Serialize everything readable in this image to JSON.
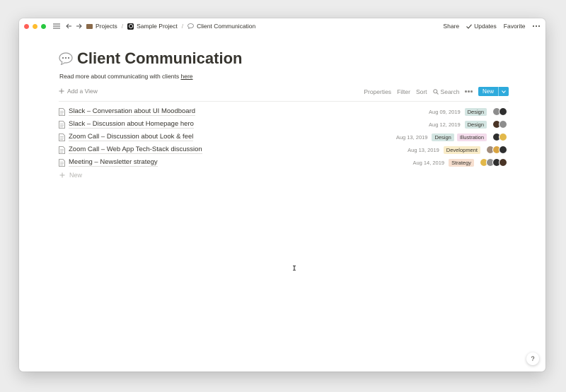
{
  "topbar": {
    "breadcrumbs": [
      {
        "label": "Projects",
        "icon": "briefcase-icon"
      },
      {
        "label": "Sample Project",
        "icon": "project-icon"
      },
      {
        "label": "Client Communication",
        "icon": "speech-bubble-icon"
      }
    ],
    "share_label": "Share",
    "updates_label": "Updates",
    "favorite_label": "Favorite"
  },
  "page": {
    "title": "Client Communication",
    "intro_text": "Read more about communicating with clients ",
    "intro_link": "here"
  },
  "viewbar": {
    "add_view": "Add a View",
    "properties": "Properties",
    "filter": "Filter",
    "sort": "Sort",
    "search": "Search",
    "new_button": "New"
  },
  "rows": [
    {
      "title": "Slack – Conversation about UI Moodboard",
      "date": "Aug 09, 2019",
      "tags": [
        "Design"
      ],
      "avatars": [
        "#8d8d8d",
        "#2f2f2f"
      ]
    },
    {
      "title": "Slack – Discussion about Homepage hero",
      "date": "Aug 12, 2019",
      "tags": [
        "Design"
      ],
      "avatars": [
        "#4a3426",
        "#8d8d8d"
      ]
    },
    {
      "title": "Zoom Call – Discussion about Look & feel",
      "date": "Aug 13, 2019",
      "tags": [
        "Design",
        "Illustration"
      ],
      "avatars": [
        "#2f2f2f",
        "#e2b84a"
      ]
    },
    {
      "title": "Zoom Call – Web App Tech-Stack discussion",
      "date": "Aug 13, 2019",
      "tags": [
        "Development"
      ],
      "avatars": [
        "#a08c7c",
        "#d9a441",
        "#2f2f2f"
      ]
    },
    {
      "title": "Meeting – Newsletter strategy",
      "date": "Aug 14, 2019",
      "tags": [
        "Strategy"
      ],
      "avatars": [
        "#e2b84a",
        "#8d8d8d",
        "#2f2f2f",
        "#4a3426"
      ]
    }
  ],
  "new_row_label": "New",
  "help_label": "?",
  "tag_colors": {
    "Design": "#d3e5e2",
    "Illustration": "#f4dcec",
    "Development": "#f9ecc8",
    "Strategy": "#f7dfcf"
  },
  "colors": {
    "accent": "#2eaadc",
    "text": "#37352f",
    "muted": "#8c8b88"
  }
}
